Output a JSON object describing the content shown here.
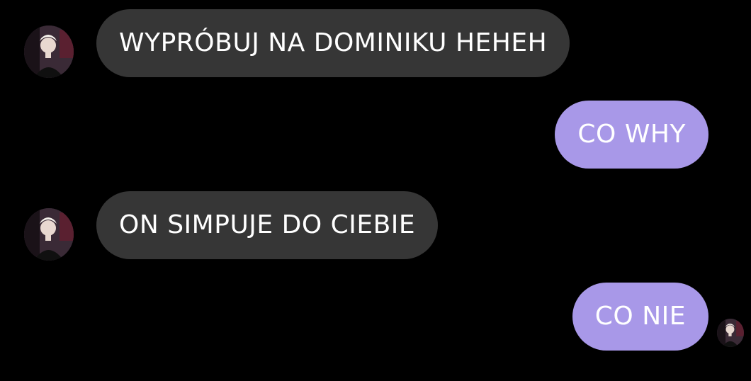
{
  "conversation": {
    "messages": [
      {
        "sender": "them",
        "text": "WYPRÓBUJ NA DOMINIKU HEHEH"
      },
      {
        "sender": "me",
        "text": "CO WHY"
      },
      {
        "sender": "them",
        "text": "ON SIMPUJE DO CIEBIE"
      },
      {
        "sender": "me",
        "text": "CO NIE"
      }
    ]
  },
  "colors": {
    "background": "#000000",
    "incoming_bubble": "#363636",
    "outgoing_bubble": "#a898e8",
    "text": "#ffffff"
  },
  "icons": {
    "avatar": "contact-avatar-photo"
  }
}
